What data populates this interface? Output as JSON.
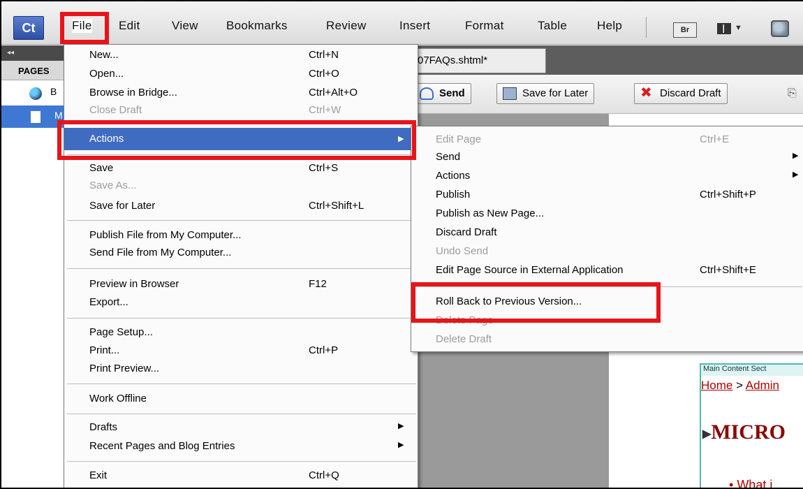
{
  "app": {
    "logo": "Ct"
  },
  "menubar": {
    "items": [
      "File",
      "Edit",
      "View",
      "Bookmarks",
      "Review",
      "Insert",
      "Format",
      "Table",
      "Help"
    ],
    "bridge_label": "Br"
  },
  "left_panel": {
    "collapse": "◂◂",
    "tab": "PAGES",
    "row_b": "B",
    "row_m": "M"
  },
  "document": {
    "tab_title": "07FAQs.shtml*",
    "toolbar": {
      "send": "Send",
      "save_for_later": "Save for Later",
      "discard_draft": "Discard Draft"
    },
    "section_label": "Main Content Sect",
    "crumb_home": "Home",
    "crumb_sep": " > ",
    "crumb_next": "Admin",
    "heading": "MICRO",
    "bullet": "What i"
  },
  "file_menu": {
    "items": [
      {
        "label": "New...",
        "shortcut": "Ctrl+N"
      },
      {
        "label": "Open...",
        "shortcut": "Ctrl+O"
      },
      {
        "label": "Browse in Bridge...",
        "shortcut": "Ctrl+Alt+O"
      },
      {
        "label": "Close Draft",
        "shortcut": "Ctrl+W",
        "disabled": true
      },
      {
        "label": "Actions",
        "submenu": true,
        "highlighted": true
      },
      {
        "label": "Save",
        "shortcut": "Ctrl+S"
      },
      {
        "label": "Save As...",
        "disabled": true
      },
      {
        "label": "Save for Later",
        "shortcut": "Ctrl+Shift+L"
      },
      {
        "label": "Publish File from My Computer..."
      },
      {
        "label": "Send File from My Computer..."
      },
      {
        "label": "Preview in Browser",
        "shortcut": "F12"
      },
      {
        "label": "Export..."
      },
      {
        "label": "Page Setup..."
      },
      {
        "label": "Print...",
        "shortcut": "Ctrl+P"
      },
      {
        "label": "Print Preview..."
      },
      {
        "label": "Work Offline"
      },
      {
        "label": "Drafts",
        "submenu": true
      },
      {
        "label": "Recent Pages and Blog Entries",
        "submenu": true
      },
      {
        "label": "Exit",
        "shortcut": "Ctrl+Q"
      }
    ]
  },
  "actions_menu": {
    "items": [
      {
        "label": "Edit Page",
        "shortcut": "Ctrl+E",
        "disabled": true
      },
      {
        "label": "Send",
        "submenu": true
      },
      {
        "label": "Actions",
        "submenu": true
      },
      {
        "label": "Publish",
        "shortcut": "Ctrl+Shift+P"
      },
      {
        "label": "Publish as New Page..."
      },
      {
        "label": "Discard Draft"
      },
      {
        "label": "Undo Send",
        "disabled": true
      },
      {
        "label": "Edit Page Source in External Application",
        "shortcut": "Ctrl+Shift+E"
      },
      {
        "label": "Roll Back to Previous Version..."
      },
      {
        "label": "Delete Page",
        "disabled": true
      },
      {
        "label": "Delete Draft",
        "disabled": true
      }
    ]
  },
  "colors": {
    "highlight": "#3f6cc0",
    "annotation": "#e8141a",
    "disabled_text": "#9c9c9c"
  }
}
